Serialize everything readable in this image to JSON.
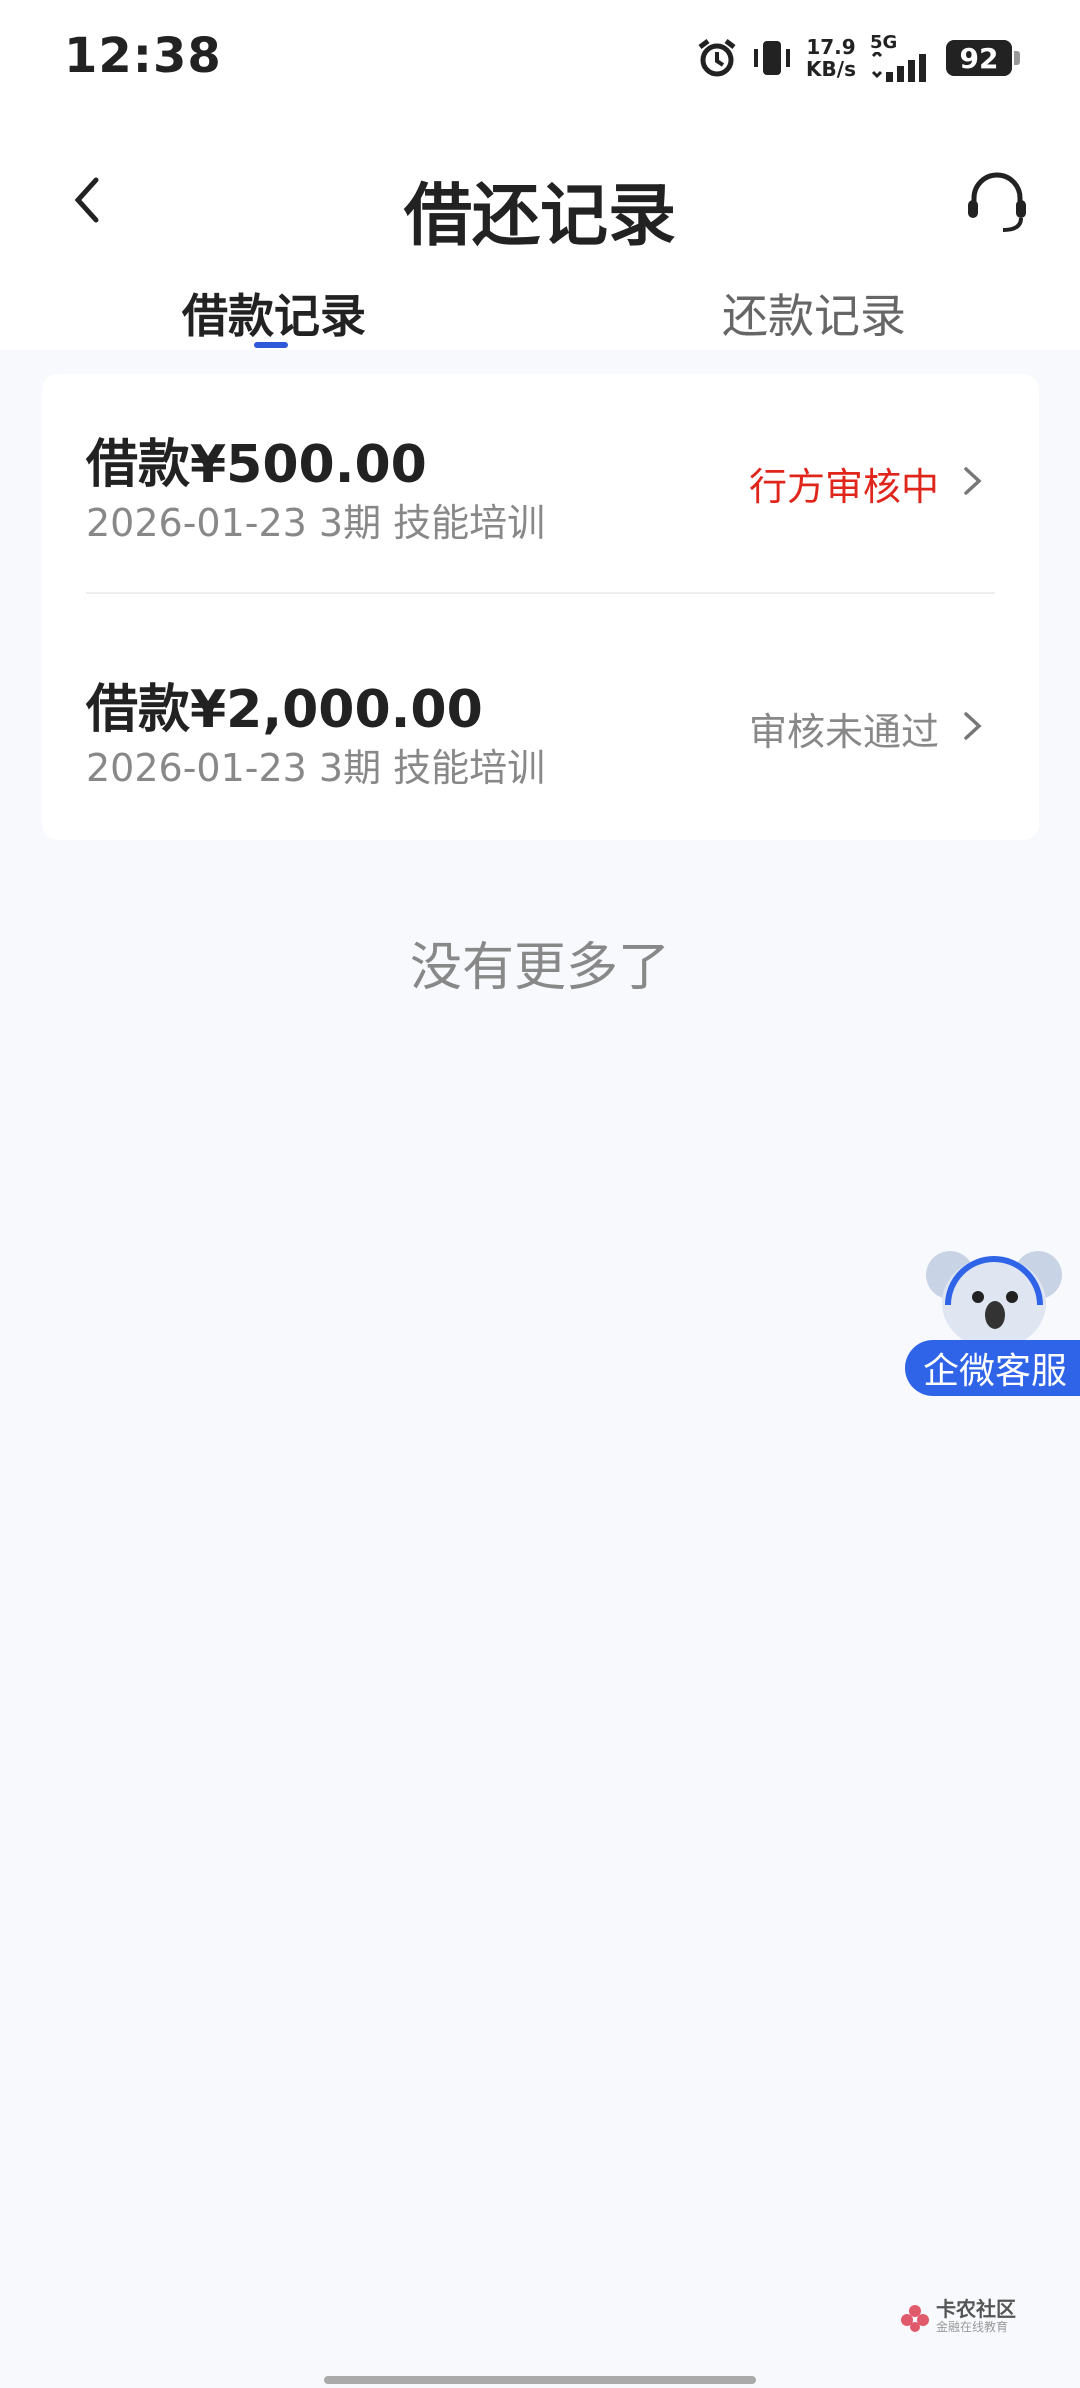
{
  "status_bar": {
    "time": "12:38",
    "net_speed_value": "17.9",
    "net_speed_unit": "KB/s",
    "network_type": "5G",
    "battery": "92"
  },
  "header": {
    "title": "借还记录",
    "tabs": [
      {
        "label": "借款记录",
        "active": true
      },
      {
        "label": "还款记录",
        "active": false
      }
    ]
  },
  "records": [
    {
      "amount": "借款¥500.00",
      "meta": "2026-01-23 3期  技能培训",
      "status": "行方审核中",
      "status_color": "#e0251b"
    },
    {
      "amount": "借款¥2,000.00",
      "meta": "2026-01-23 3期  技能培训",
      "status": "审核未通过",
      "status_color": "#888888"
    }
  ],
  "footer_note": "没有更多了",
  "float_service": {
    "label": "企微客服"
  },
  "watermark": {
    "title": "卡农社区",
    "subtitle": "金融在线教育"
  },
  "colors": {
    "accent": "#2e59d9",
    "pending": "#e0251b",
    "rejected": "#888888",
    "page_bg": "#f7f9fd"
  }
}
